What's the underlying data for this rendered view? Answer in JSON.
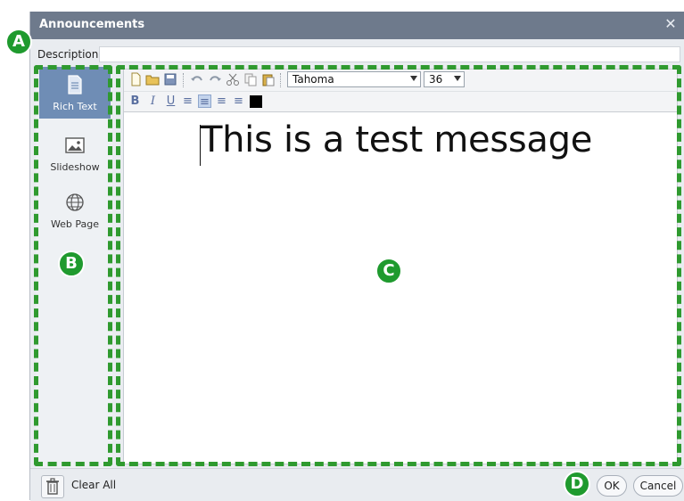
{
  "dialog": {
    "title": "Announcements",
    "close_glyph": "✕"
  },
  "description": {
    "label": "Description:",
    "value": "",
    "placeholder": ""
  },
  "sidebar": {
    "items": [
      {
        "label": "Rich Text",
        "icon": "document-icon",
        "active": true
      },
      {
        "label": "Slideshow",
        "icon": "image-icon",
        "active": false
      },
      {
        "label": "Web Page",
        "icon": "globe-icon",
        "active": false
      }
    ]
  },
  "toolbar": {
    "font": "Tahoma",
    "size": "36",
    "buttons": [
      "new-icon",
      "open-icon",
      "save-icon",
      "undo-icon",
      "redo-icon",
      "cut-icon",
      "copy-icon",
      "paste-icon"
    ],
    "format": [
      {
        "glyph": "B",
        "name": "bold"
      },
      {
        "glyph": "I",
        "name": "italic"
      },
      {
        "glyph": "U",
        "name": "underline"
      },
      {
        "glyph": "≡",
        "name": "align-left"
      },
      {
        "glyph": "≡",
        "name": "align-center"
      },
      {
        "glyph": "≡",
        "name": "align-right"
      },
      {
        "glyph": "≡",
        "name": "align-justify"
      }
    ],
    "text_color": "#000000"
  },
  "editor": {
    "message": "This is a test message"
  },
  "footer": {
    "clear_label": "Clear All",
    "ok_label": "OK",
    "cancel_label": "Cancel"
  },
  "callouts": {
    "a": "A",
    "b": "B",
    "c": "C",
    "d": "D",
    "color": "#2f9a2f"
  }
}
